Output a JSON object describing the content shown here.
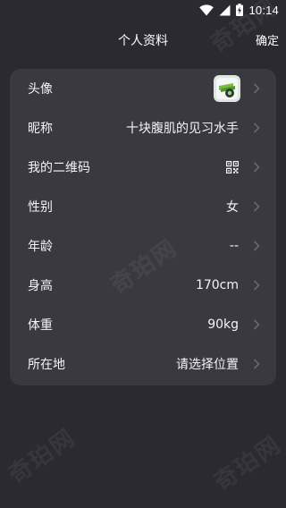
{
  "status_bar": {
    "time": "10:14",
    "icons": [
      "wifi-icon",
      "signal-icon",
      "battery-charging-icon"
    ]
  },
  "header": {
    "title": "个人资料",
    "confirm_label": "确定"
  },
  "profile": {
    "rows": [
      {
        "label": "头像",
        "kind": "avatar",
        "icon": "avatar-image"
      },
      {
        "label": "昵称",
        "value": "十块腹肌的见习水手"
      },
      {
        "label": "我的二维码",
        "kind": "qr",
        "icon": "qr-code-icon"
      },
      {
        "label": "性别",
        "value": "女"
      },
      {
        "label": "年龄",
        "value": "--"
      },
      {
        "label": "身高",
        "value": "170cm"
      },
      {
        "label": "体重",
        "value": "90kg"
      },
      {
        "label": "所在地",
        "value": "请选择位置"
      }
    ]
  },
  "watermark": {
    "text": "奇珀网"
  },
  "colors": {
    "background": "#2b2a31",
    "card": "#3a3940",
    "text": "#f4f4f7",
    "chevron": "#6f6e76"
  }
}
